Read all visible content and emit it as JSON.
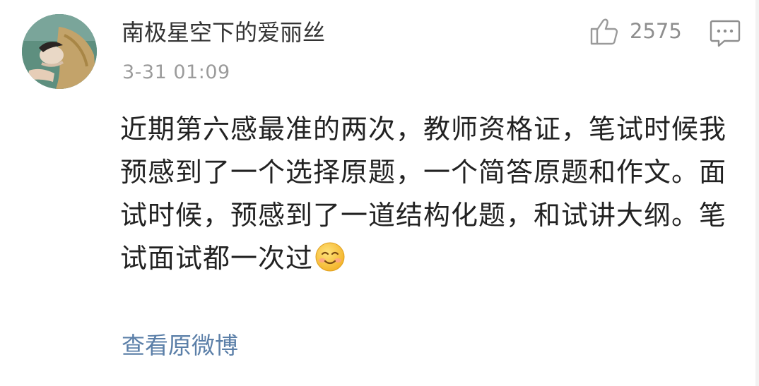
{
  "comment": {
    "username": "南极星空下的爱丽丝",
    "timestamp": "3-31 01:09",
    "like_count": "2575",
    "content": "近期第六感最准的两次，教师资格证，笔试时候我预感到了一个选择原题，一个简答原题和作文。面试时候，预感到了一道结构化题，和试讲大纲。笔试面试都一次过",
    "view_original_label": "查看原微博",
    "icons": {
      "avatar": "user-avatar",
      "like": "thumbs-up-icon",
      "reply": "comment-reply-icon",
      "emoji": "smiling-face-emoji"
    },
    "colors": {
      "link": "#5b7fa8",
      "meta": "#9b9b9b",
      "text": "#222222"
    }
  }
}
